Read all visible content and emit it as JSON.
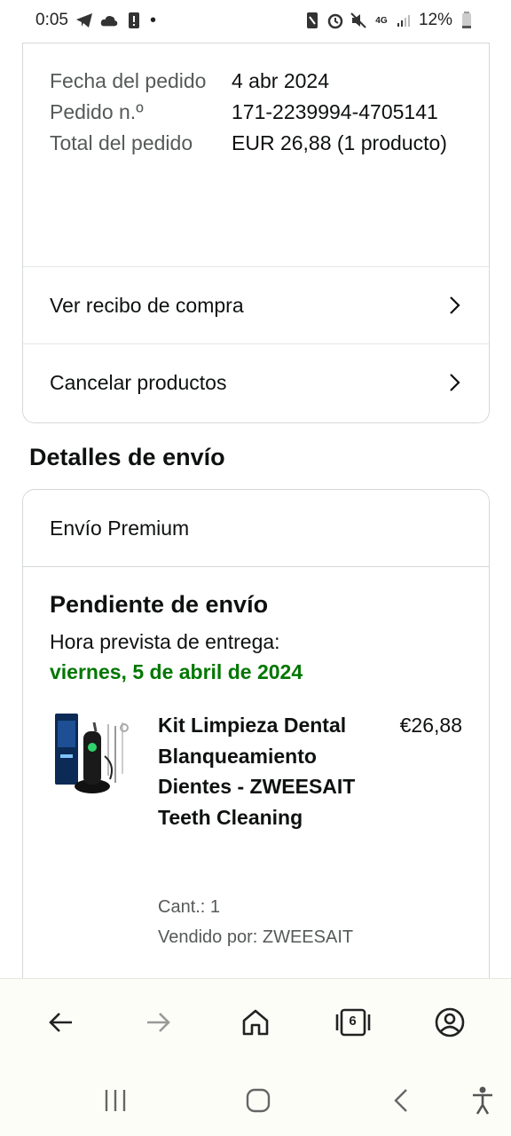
{
  "status_bar": {
    "time": "0:05",
    "battery": "12%"
  },
  "order_info": {
    "rows": [
      {
        "label": "Fecha del pedido",
        "value": "4 abr 2024"
      },
      {
        "label": "Pedido n.º",
        "value": "171-2239994-4705141"
      },
      {
        "label": "Total del pedido",
        "value": "EUR 26,88 (1 producto)"
      }
    ],
    "links": [
      {
        "label": "Ver recibo de compra"
      },
      {
        "label": "Cancelar productos"
      }
    ]
  },
  "shipping": {
    "section_title": "Detalles de envío",
    "method": "Envío Premium",
    "status": "Pendiente de envío",
    "eta_label": "Hora prevista de entrega:",
    "eta_date": "viernes, 5 de abril de 2024",
    "colors": {
      "eta": "#007600"
    },
    "product": {
      "title": "Kit Limpieza Dental Blanqueamiento Dientes - ZWEESAIT Teeth Cleaning",
      "price": "€26,88",
      "qty": "Cant.: 1",
      "seller": "Vendido por: ZWEESAIT"
    }
  },
  "bottom_nav": {
    "tab_count": "6",
    "items": [
      "back-arrow-icon",
      "forward-arrow-icon",
      "home-icon",
      "tabs-icon",
      "account-icon"
    ]
  }
}
